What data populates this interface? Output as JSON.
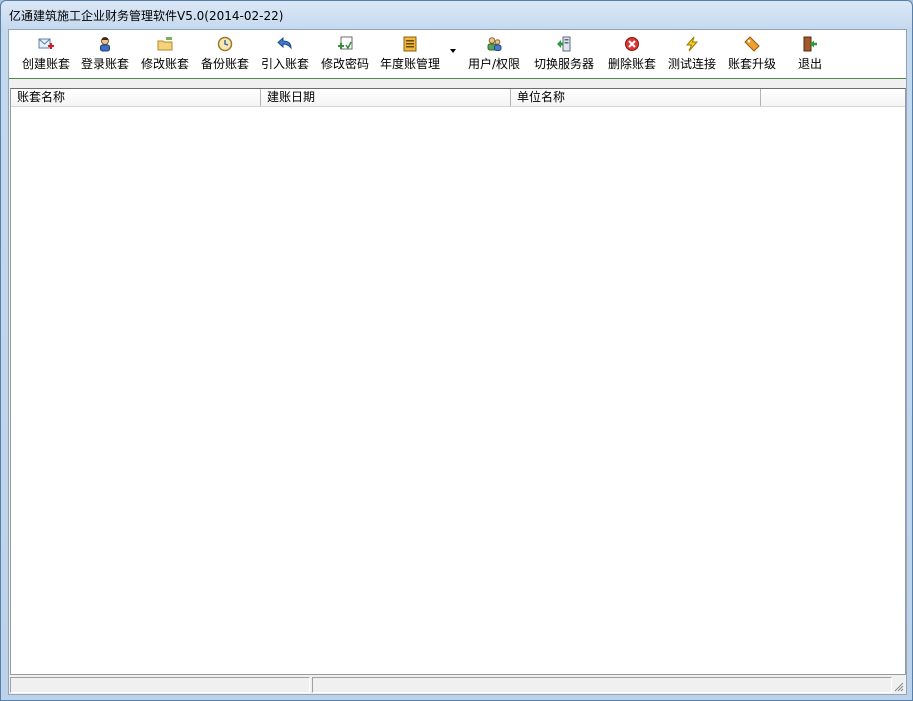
{
  "window": {
    "title": "亿通建筑施工企业财务管理软件V5.0(2014-02-22)"
  },
  "toolbar": {
    "items": [
      {
        "label": "创建账套",
        "icon": "create-ledger-icon"
      },
      {
        "label": "登录账套",
        "icon": "login-user-icon"
      },
      {
        "label": "修改账套",
        "icon": "edit-ledger-icon"
      },
      {
        "label": "备份账套",
        "icon": "backup-clock-icon"
      },
      {
        "label": "引入账套",
        "icon": "import-arrow-icon"
      },
      {
        "label": "修改密码",
        "icon": "change-password-icon"
      },
      {
        "label": "年度账管理",
        "icon": "annual-book-icon"
      },
      {
        "label": "用户/权限",
        "icon": "users-icon"
      },
      {
        "label": "切换服务器",
        "icon": "server-switch-icon"
      },
      {
        "label": "删除账套",
        "icon": "delete-icon"
      },
      {
        "label": "测试连接",
        "icon": "lightning-icon"
      },
      {
        "label": "账套升级",
        "icon": "tag-upgrade-icon"
      },
      {
        "label": "退出",
        "icon": "exit-door-icon"
      }
    ]
  },
  "list": {
    "columns": [
      "账套名称",
      "建账日期",
      "单位名称",
      ""
    ],
    "rows": []
  },
  "status": {
    "panels": [
      "",
      ""
    ]
  },
  "colors": {
    "accent_green": "#4c8a4c",
    "delete_red": "#d03030",
    "title_bar_blue": "#c4d8ee"
  }
}
